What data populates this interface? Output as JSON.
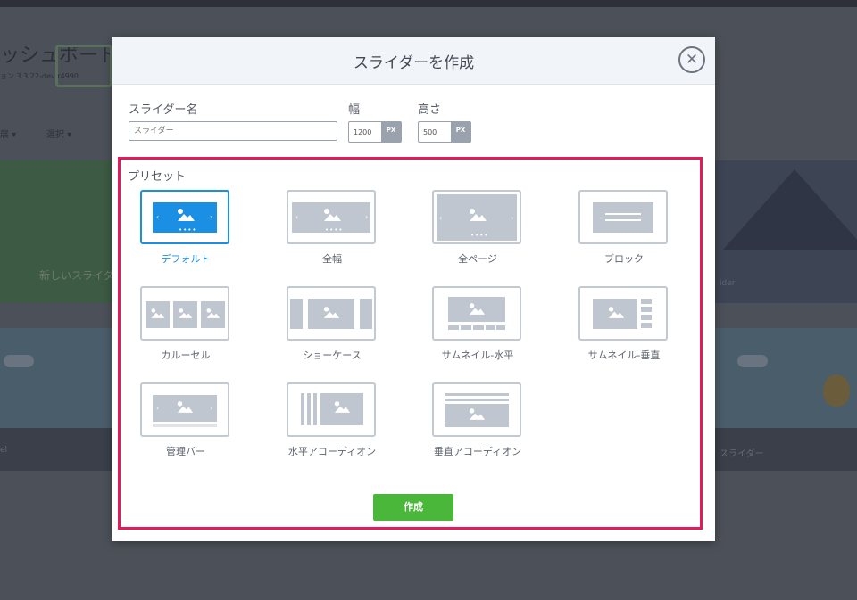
{
  "background": {
    "dashboard_title": "ッシュボード",
    "version": "ョン 3.3.22-dev-r4990",
    "filter_1": "展 ▾",
    "filter_2": "選択 ▾",
    "new_slider_label": "新しいスライダ",
    "tile_label_mountain": "ider",
    "strip_label_left": "el",
    "strip_label_right": "スライダー"
  },
  "modal": {
    "title": "スライダーを作成",
    "close_icon": "circle-x-icon",
    "name_label": "スライダー名",
    "name_placeholder": "スライダー",
    "width_label": "幅",
    "width_value": "1200",
    "width_unit": "PX",
    "height_label": "高さ",
    "height_value": "500",
    "height_unit": "PX",
    "preset_heading": "プリセット",
    "presets": [
      {
        "label": "デフォルト",
        "selected": true
      },
      {
        "label": "全幅",
        "selected": false
      },
      {
        "label": "全ページ",
        "selected": false
      },
      {
        "label": "ブロック",
        "selected": false
      },
      {
        "label": "カルーセル",
        "selected": false
      },
      {
        "label": "ショーケース",
        "selected": false
      },
      {
        "label": "サムネイル-水平",
        "selected": false
      },
      {
        "label": "サムネイル-垂直",
        "selected": false
      },
      {
        "label": "管理バー",
        "selected": false
      },
      {
        "label": "水平アコーディオン",
        "selected": false
      },
      {
        "label": "垂直アコーディオン",
        "selected": false
      }
    ],
    "create_label": "作成",
    "colors": {
      "accent": "#1b8fe3",
      "highlight": "#e8195a",
      "button": "#4bb73a"
    }
  }
}
